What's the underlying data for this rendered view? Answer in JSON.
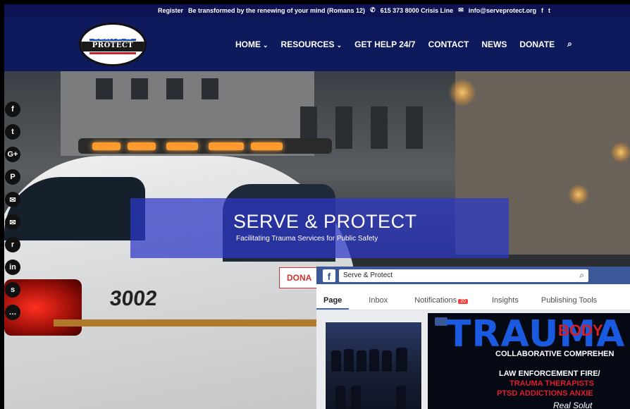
{
  "topbar": {
    "register": "Register",
    "tagline": "Be transformed by the renewing of your mind (Romans 12)",
    "crisis_line": "615 373 8000 Crisis Line",
    "email": "info@serveprotect.org"
  },
  "logo": {
    "line1": "SERVE &",
    "line2": "PROTECT"
  },
  "nav": {
    "home": "HOME",
    "resources": "RESOURCES",
    "get_help": "GET HELP 24/7",
    "contact": "CONTACT",
    "news": "NEWS",
    "donate": "DONATE"
  },
  "hero": {
    "title": "SERVE & PROTECT",
    "subtitle": "Facilitating Trauma Services for Public Safety",
    "car_number": "3002",
    "donate_partial": "DONA"
  },
  "social": [
    "f",
    "t",
    "G+",
    "P",
    "✉",
    "✉",
    "r",
    "in",
    "s",
    "…"
  ],
  "facebook": {
    "search_value": "Serve & Protect",
    "tabs": [
      "Page",
      "Inbox",
      "Notifications",
      "Insights",
      "Publishing Tools"
    ],
    "notif_count": "20",
    "cover": {
      "big": "TRAUMA",
      "body": "BODY",
      "line1": "COLLABORATIVE   COMPREHEN",
      "line2": "LAW ENFORCEMENT   FIRE/",
      "line3": "TRAUMA THERAPISTS",
      "line4": "PTSD ADDICTIONS ANXIE",
      "line5": "Real Solut"
    }
  }
}
